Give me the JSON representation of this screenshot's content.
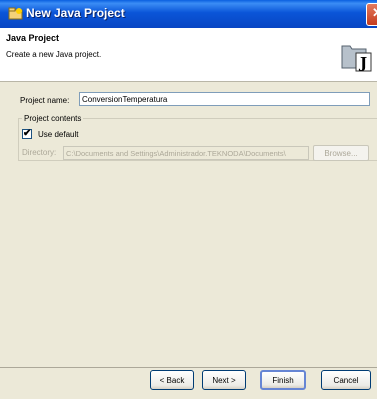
{
  "window": {
    "title": "New Java Project",
    "close_symbol": "✕"
  },
  "header": {
    "title": "Java Project",
    "description": "Create a new Java project.",
    "banner_letter": "J"
  },
  "form": {
    "project_name_label": "Project name:",
    "project_name_value": "ConversionTemperatura",
    "contents_group_title": "Project contents",
    "use_default_label": "Use default",
    "use_default_checked": "✔",
    "directory_label": "Directory:",
    "directory_value": "C:\\Documents and Settings\\Administrador.TEKNODA\\Documents\\",
    "browse_label": "Browse..."
  },
  "buttons": {
    "back": "< Back",
    "next": "Next >",
    "finish": "Finish",
    "cancel": "Cancel"
  },
  "colors": {
    "title_bar": "#0a55d8",
    "dialog_bg": "#ece9d8",
    "header_bg": "#ffffff",
    "disabled_text": "#aca899"
  }
}
